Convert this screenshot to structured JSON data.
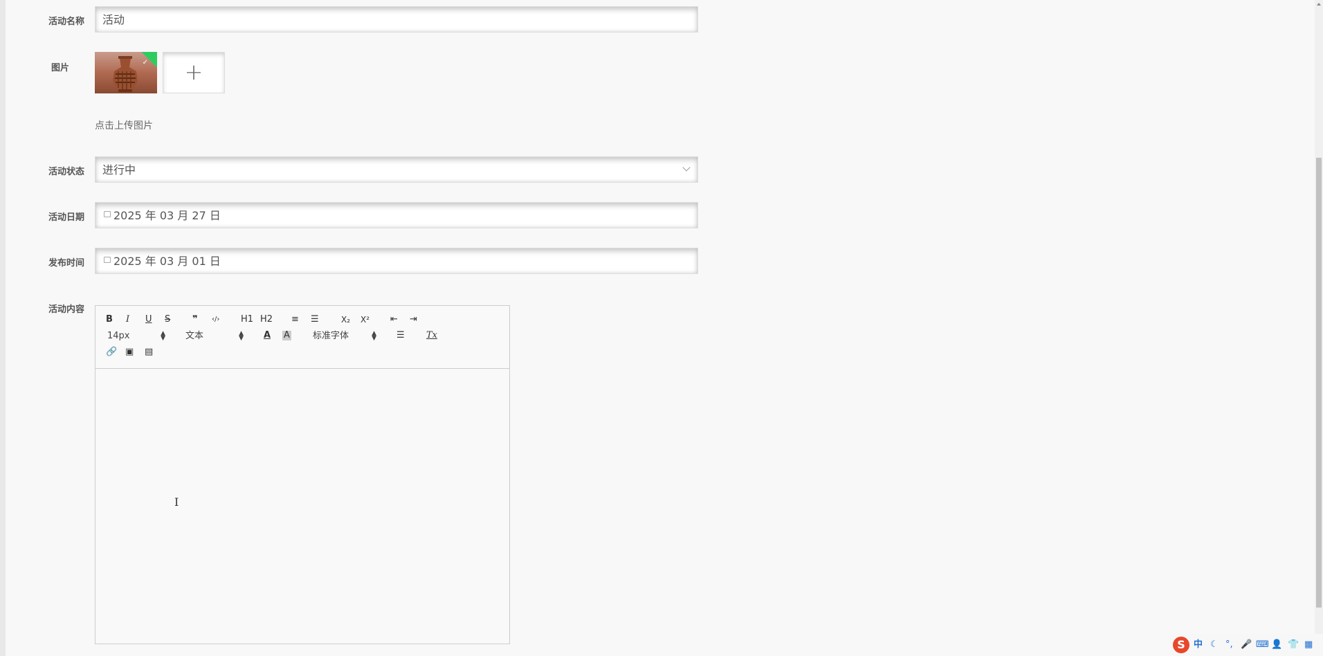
{
  "form": {
    "name": {
      "label": "活动名称",
      "value": "活动"
    },
    "image": {
      "label": "图片",
      "add_symbol": "+",
      "hint": "点击上传图片"
    },
    "status": {
      "label": "活动状态",
      "value": "进行中"
    },
    "date": {
      "label": "活动日期",
      "value": "2025 年 03 月 27 日"
    },
    "publish": {
      "label": "发布时间",
      "value": "2025 年 03 月 01 日"
    },
    "content": {
      "label": "活动内容"
    }
  },
  "editor": {
    "toolbar": {
      "bold": "B",
      "italic": "I",
      "underline": "U",
      "strike": "S",
      "quote": "❞",
      "code": "‹/›",
      "h1": "H1",
      "h2": "H2",
      "ordered_list": "≡",
      "bullet_list": "☰",
      "sub": "X₂",
      "sup": "X²",
      "outdent": "⇤",
      "indent": "⇥",
      "size_value": "14px",
      "header_value": "文本",
      "font_value": "标准字体",
      "clean": "Tx"
    }
  },
  "ime": {
    "lang": "中",
    "logo": "S"
  }
}
